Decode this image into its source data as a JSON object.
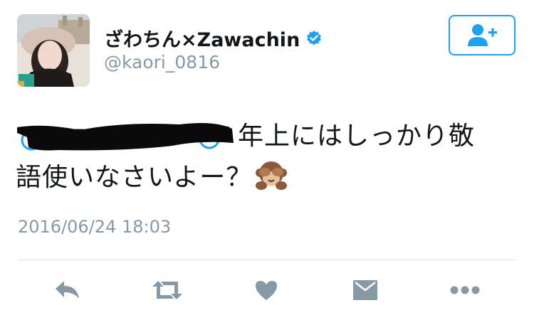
{
  "user": {
    "display_name": "ざわちん×Zawachin",
    "handle": "@kaori_0816",
    "verified": true,
    "verified_color": "#1da1f2"
  },
  "follow_button": {
    "icon": "add-user-icon"
  },
  "tweet": {
    "line1_text": "年上にはしっかり敬",
    "line2_text": "語使いなさいよー？",
    "emoji": "see-no-evil-monkey",
    "timestamp": "2016/06/24 18:03"
  },
  "actions": {
    "icons": [
      "reply-icon",
      "retweet-icon",
      "like-icon",
      "message-icon",
      "more-icon"
    ]
  },
  "colors": {
    "text": "#14171a",
    "secondary": "#8899a6",
    "accent": "#1da1f2",
    "action_gray": "#8899a6"
  }
}
